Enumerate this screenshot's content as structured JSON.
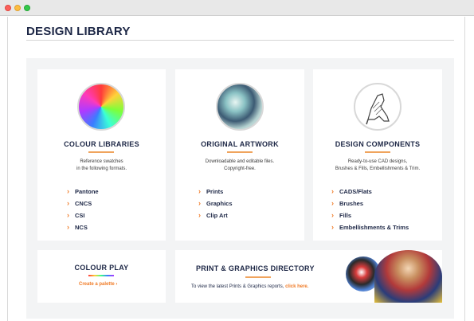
{
  "page_title": "DESIGN LIBRARY",
  "cards": {
    "colour_libraries": {
      "title": "COLOUR LIBRARIES",
      "description_line1": "Reference swatches",
      "description_line2": "in the following formats.",
      "items": [
        "Pantone",
        "CNCS",
        "CSI",
        "NCS"
      ]
    },
    "original_artwork": {
      "title": "ORIGINAL ARTWORK",
      "description_line1": "Downloadable and editable files.",
      "description_line2": "Copyright-free.",
      "items": [
        "Prints",
        "Graphics",
        "Clip Art"
      ]
    },
    "design_components": {
      "title": "DESIGN COMPONENTS",
      "description_line1": "Ready-to-use CAD designs,",
      "description_line2": "Brushes & Fills, Embellishments & Trim.",
      "items": [
        "CADS/Flats",
        "Brushes",
        "Fills",
        "Embellishments & Trims"
      ]
    },
    "colour_play": {
      "title": "COLOUR PLAY",
      "link": "Create a palette"
    },
    "print_directory": {
      "title": "PRINT & GRAPHICS DIRECTORY",
      "text": "To view the latest Prints & Graphics reports,",
      "link": "click here."
    }
  },
  "colors": {
    "accent_orange": "#f07c28",
    "navy": "#1d2746",
    "panel_bg": "#f3f4f5"
  },
  "icons": {
    "chevron": "›"
  }
}
